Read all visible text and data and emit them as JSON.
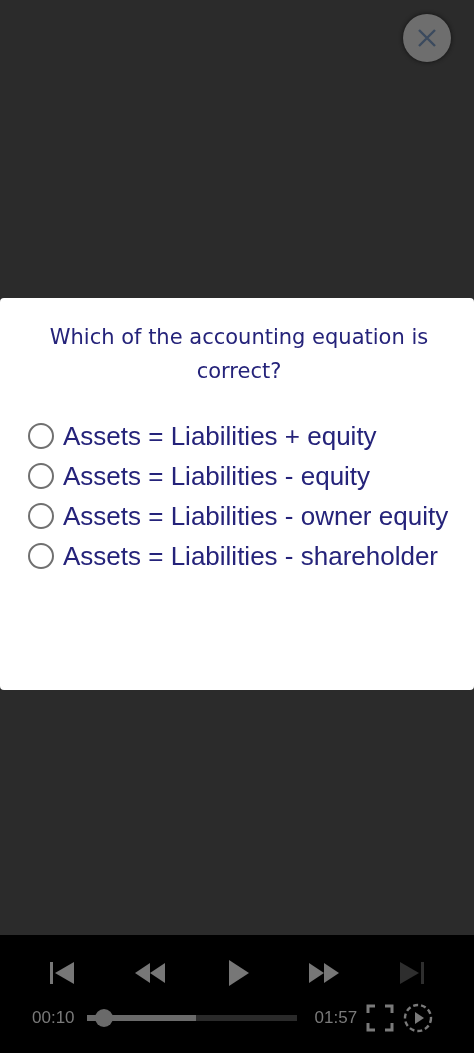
{
  "quiz": {
    "question": "Which of the accounting equation is correct?",
    "options": [
      {
        "label": "Assets = Liabilities + equity",
        "selected": false
      },
      {
        "label": "Assets = Liabilities - equity",
        "selected": false
      },
      {
        "label": "Assets = Liabilities - owner equity",
        "selected": false
      },
      {
        "label": "Assets = Liabilities - shareholder",
        "selected": false
      }
    ]
  },
  "player": {
    "controls": [
      {
        "kind": "skip-previous",
        "disabled": false
      },
      {
        "kind": "rewind",
        "disabled": false
      },
      {
        "kind": "play",
        "disabled": false
      },
      {
        "kind": "fast-forward",
        "disabled": false
      },
      {
        "kind": "skip-next",
        "disabled": true
      }
    ],
    "elapsed": "00:10",
    "duration": "01:57",
    "progress": {
      "level": 0.085
    },
    "buffer": {
      "level": 0.52
    }
  }
}
